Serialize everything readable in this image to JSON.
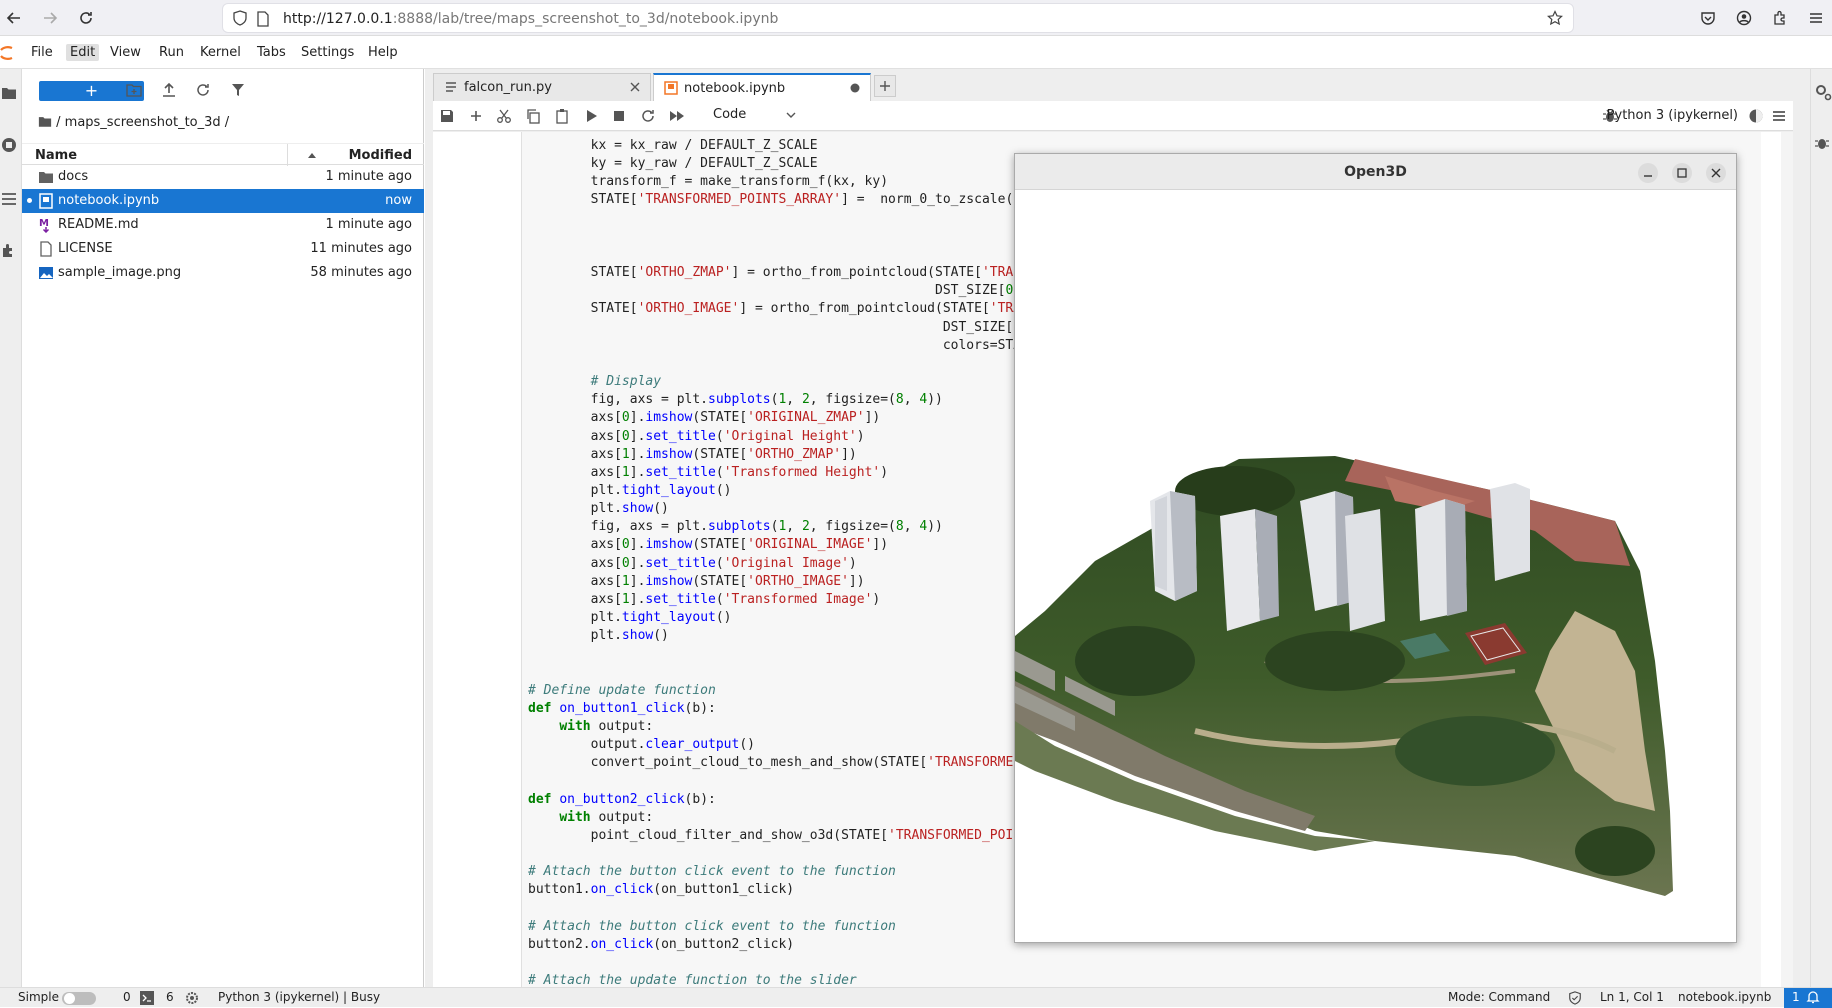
{
  "browser": {
    "url_host": "http://127.0.0.1",
    "url_rest": ":8888/lab/tree/maps_screenshot_to_3d/notebook.ipynb"
  },
  "menu": [
    "File",
    "Edit",
    "View",
    "Run",
    "Kernel",
    "Tabs",
    "Settings",
    "Help"
  ],
  "filebrowser": {
    "new_label": "+",
    "path": "/ maps_screenshot_to_3d /",
    "col_name": "Name",
    "col_modified": "Modified",
    "files": [
      {
        "name": "docs",
        "modified": "1 minute ago",
        "icon": "folder-icon"
      },
      {
        "name": "notebook.ipynb",
        "modified": "now",
        "icon": "notebook-icon"
      },
      {
        "name": "README.md",
        "modified": "1 minute ago",
        "icon": "markdown-icon"
      },
      {
        "name": "LICENSE",
        "modified": "11 minutes ago",
        "icon": "file-icon"
      },
      {
        "name": "sample_image.png",
        "modified": "58 minutes ago",
        "icon": "image-icon"
      }
    ]
  },
  "tabs": [
    {
      "label": "falcon_run.py"
    },
    {
      "label": "notebook.ipynb"
    }
  ],
  "toolbar": {
    "cell_type": "Code",
    "kernel": "Python 3 (ipykernel)"
  },
  "code_lines": [
    "        kx = kx_raw / DEFAULT_Z_SCALE",
    "        ky = ky_raw / DEFAULT_Z_SCALE",
    "        transform_f = make_transform_f(kx, ky)",
    "        STATE['TRANSFORMED_POINTS_ARRAY'] =  norm_0_to_zscale(",
    "",
    "",
    "",
    "        STATE['ORTHO_ZMAP'] = ortho_from_pointcloud(STATE['TRAN",
    "                                                    DST_SIZE[0",
    "        STATE['ORTHO_IMAGE'] = ortho_from_pointcloud(STATE['TRA",
    "                                                     DST_SIZE[",
    "                                                     colors=STA",
    "",
    "        # Display",
    "        fig, axs = plt.subplots(1, 2, figsize=(8, 4))",
    "        axs[0].imshow(STATE['ORIGINAL_ZMAP'])",
    "        axs[0].set_title('Original Height')",
    "        axs[1].imshow(STATE['ORTHO_ZMAP'])",
    "        axs[1].set_title('Transformed Height')",
    "        plt.tight_layout()",
    "        plt.show()",
    "        fig, axs = plt.subplots(1, 2, figsize=(8, 4))",
    "        axs[0].imshow(STATE['ORIGINAL_IMAGE'])",
    "        axs[0].set_title('Original Image')",
    "        axs[1].imshow(STATE['ORTHO_IMAGE'])",
    "        axs[1].set_title('Transformed Image')",
    "        plt.tight_layout()",
    "        plt.show()",
    "",
    "",
    "# Define update function",
    "def on_button1_click(b):",
    "    with output:",
    "        output.clear_output()",
    "        convert_point_cloud_to_mesh_and_show(STATE['TRANSFORME",
    "",
    "def on_button2_click(b):",
    "    with output:",
    "        point_cloud_filter_and_show_o3d(STATE['TRANSFORMED_POI",
    "",
    "# Attach the button click event to the function",
    "button1.on_click(on_button1_click)",
    "",
    "# Attach the button click event to the function",
    "button2.on_click(on_button2_click)",
    "",
    "# Attach the update function to the slider"
  ],
  "open3d": {
    "title": "Open3D"
  },
  "status": {
    "mode_label": "Simple",
    "terminals": "0",
    "kernels": "6",
    "kernel_status": "Python 3 (ipykernel) | Busy",
    "mode": "Mode: Command",
    "position": "Ln 1, Col 1",
    "file": "notebook.ipynb",
    "notifications": "1"
  },
  "colors": {
    "accent": "#1976d2",
    "keyword": "#008000",
    "string": "#ba2121",
    "comment": "#3d7b7b"
  }
}
